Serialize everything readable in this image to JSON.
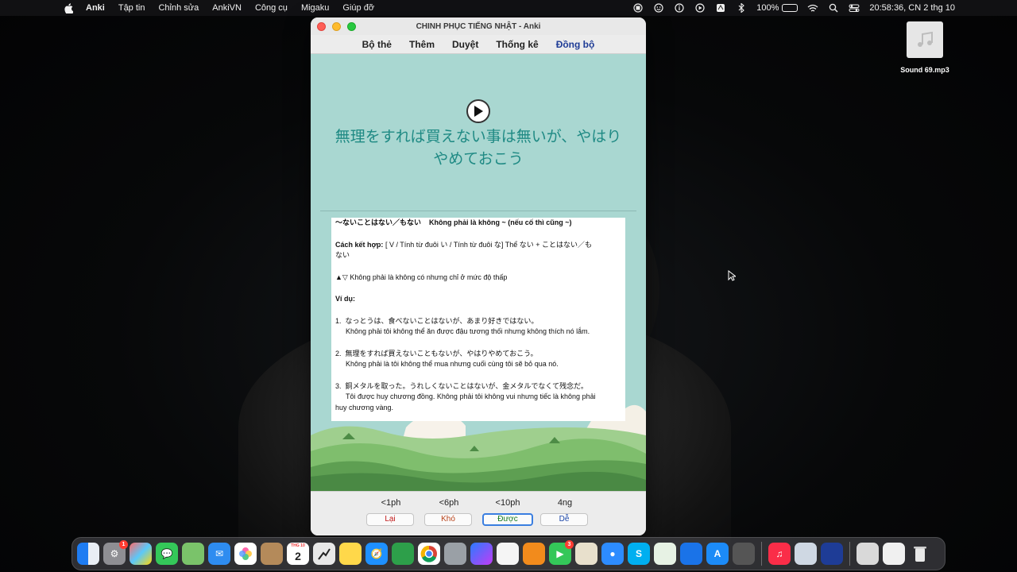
{
  "menubar": {
    "app_name": "Anki",
    "items": [
      "Tập tin",
      "Chỉnh sửa",
      "AnkiVN",
      "Công cụ",
      "Migaku",
      "Giúp đỡ"
    ],
    "battery": "100%",
    "clock": "20:58:36, CN 2 thg 10"
  },
  "desktop": {
    "file_name": "Sound 69.mp3"
  },
  "window": {
    "title": "CHINH PHỤC TIẾNG NHẬT - Anki",
    "toolbar": [
      "Bộ thẻ",
      "Thêm",
      "Duyệt",
      "Thống kê",
      "Đồng bộ"
    ]
  },
  "card": {
    "sentence_line1": "無理をすれば買えない事は無いが、やはり",
    "sentence_line2": "やめておこう",
    "grammar_pattern": "〜ないことはない／もない",
    "grammar_meaning": "Không phải là không ~ (nếu cố thì cũng ~)",
    "usage_label": "Cách kết hợp:",
    "usage_text": "[ V / Tính từ đuôi い / Tính từ đuôi な] Thể ない + ことはない／も",
    "usage_text_2": "ない",
    "nuance": "▲▽ Không phải là không có nhưng chỉ ở mức độ thấp",
    "examples_label": "Ví dụ:",
    "examples": [
      {
        "num": "1.",
        "jp": "なっとうは、食べないことはないが、あまり好きではない。",
        "vi": "Không phải tôi không thể ăn được đậu tương thối nhưng không thích nó lắm."
      },
      {
        "num": "2.",
        "jp": "無理をすれば買えないこともないが、やはりやめておこう。",
        "vi": "Không phải là tôi không thể mua nhưng cuối cùng tôi sẽ bỏ qua nó."
      },
      {
        "num": "3.",
        "jp": "銅メタルを取った。うれしくないことはないが、金メタルでなくて残念だ。",
        "vi": "Tôi được huy chương đồng. Không phải tôi không vui nhưng tiếc là không phải",
        "vi_2": "huy chương vàng."
      }
    ]
  },
  "answers": [
    {
      "time": "<1ph",
      "label": "Lại"
    },
    {
      "time": "<6ph",
      "label": "Khó"
    },
    {
      "time": "<10ph",
      "label": "Được"
    },
    {
      "time": "4ng",
      "label": "Dễ"
    }
  ],
  "dock": {
    "calendar_month": "THG 10",
    "calendar_day": "2",
    "badges": {
      "settings": "1",
      "facetime": "3"
    }
  },
  "colors": {
    "card_background": "#a9d7d1",
    "sentence_color": "#1f8a84",
    "sync_link": "#1e3c96"
  }
}
